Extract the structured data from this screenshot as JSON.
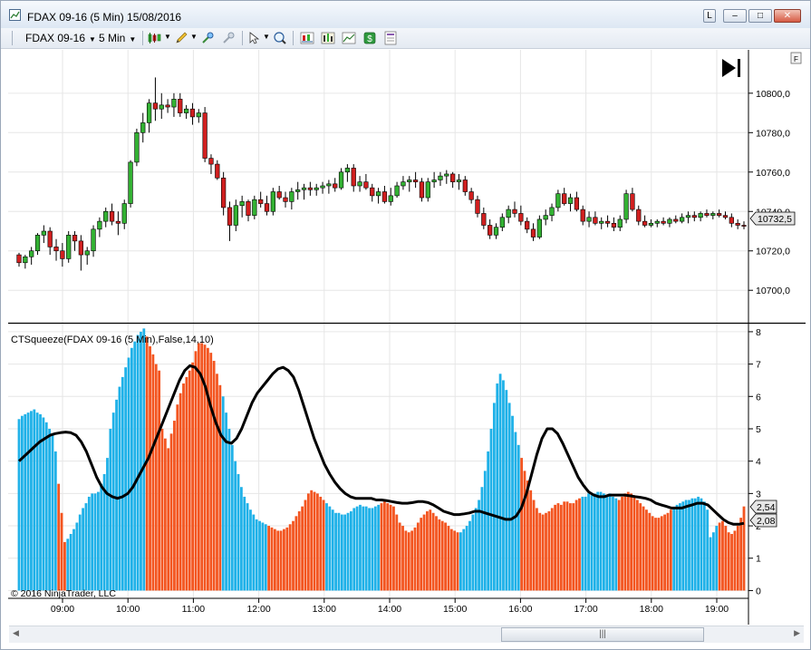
{
  "window": {
    "title": "FDAX 09-16 (5 Min)  15/08/2016",
    "buttons": {
      "link": "L",
      "minimize": "–",
      "maximize": "□",
      "close": "✕"
    }
  },
  "toolbar": {
    "instrument": "FDAX 09-16",
    "interval": "5 Min",
    "tools": [
      "chart-style-icon",
      "pencil-icon",
      "zoom-in-icon",
      "zoom-out-icon",
      "pointer-icon",
      "magnify-icon",
      "strategy-icon",
      "bars-icon",
      "line-chart-icon",
      "dollar-icon",
      "properties-icon"
    ]
  },
  "colors": {
    "up": "#33b233",
    "down": "#d11f1f",
    "cyan": "#1fb1e8",
    "orange": "#f35520",
    "line": "#000000",
    "grid": "#e6e6e6",
    "axis": "#000000"
  },
  "price_panel": {
    "f_button": "F",
    "last_price_label": "10732,5"
  },
  "indicator_panel": {
    "label": "CTSqueeze(FDAX 09-16 (5 Min),False,14,10)",
    "value_label_1": "2,54",
    "value_label_2": "2,08"
  },
  "copyright": "© 2016 NinjaTrader, LLC",
  "scrollbar": {
    "grip": "|||"
  },
  "chart_data": [
    {
      "type": "candlestick",
      "title": "FDAX 09-16 (5 Min)",
      "yticks": [
        "10700,0",
        "10720,0",
        "10740,0",
        "10760,0",
        "10780,0",
        "10800,0"
      ],
      "ytick_values": [
        10700,
        10720,
        10740,
        10760,
        10780,
        10800
      ],
      "ylim": [
        10684,
        10822
      ],
      "grid": true,
      "x_time_labels": [
        "09:00",
        "10:00",
        "11:00",
        "12:00",
        "13:00",
        "14:00",
        "15:00",
        "16:00",
        "17:00",
        "18:00",
        "19:00"
      ],
      "last_price": 10732.5,
      "ohlc": [
        [
          10718,
          10719,
          10712,
          10714
        ],
        [
          10714,
          10718,
          10711,
          10717
        ],
        [
          10717,
          10722,
          10713,
          10720
        ],
        [
          10720,
          10729,
          10718,
          10728
        ],
        [
          10728,
          10733,
          10724,
          10730
        ],
        [
          10730,
          10732,
          10718,
          10722
        ],
        [
          10722,
          10726,
          10715,
          10720
        ],
        [
          10720,
          10724,
          10712,
          10716
        ],
        [
          10716,
          10730,
          10714,
          10728
        ],
        [
          10728,
          10730,
          10720,
          10725
        ],
        [
          10725,
          10728,
          10710,
          10718
        ],
        [
          10718,
          10722,
          10713,
          10720
        ],
        [
          10720,
          10733,
          10717,
          10731
        ],
        [
          10731,
          10737,
          10727,
          10735
        ],
        [
          10735,
          10742,
          10732,
          10740
        ],
        [
          10740,
          10744,
          10733,
          10735
        ],
        [
          10735,
          10740,
          10728,
          10734
        ],
        [
          10734,
          10746,
          10731,
          10744
        ],
        [
          10744,
          10766,
          10742,
          10765
        ],
        [
          10765,
          10782,
          10763,
          10780
        ],
        [
          10780,
          10790,
          10775,
          10785
        ],
        [
          10785,
          10797,
          10780,
          10795
        ],
        [
          10795,
          10808,
          10786,
          10792
        ],
        [
          10792,
          10800,
          10787,
          10794
        ],
        [
          10794,
          10797,
          10790,
          10793
        ],
        [
          10793,
          10800,
          10788,
          10797
        ],
        [
          10797,
          10800,
          10788,
          10790
        ],
        [
          10790,
          10794,
          10787,
          10792
        ],
        [
          10792,
          10795,
          10784,
          10788
        ],
        [
          10788,
          10792,
          10785,
          10790
        ],
        [
          10790,
          10793,
          10765,
          10767
        ],
        [
          10767,
          10769,
          10759,
          10764
        ],
        [
          10764,
          10766,
          10756,
          10757
        ],
        [
          10757,
          10760,
          10738,
          10742
        ],
        [
          10742,
          10745,
          10725,
          10733
        ],
        [
          10733,
          10746,
          10730,
          10743
        ],
        [
          10743,
          10748,
          10737,
          10745
        ],
        [
          10745,
          10746,
          10735,
          10738
        ],
        [
          10738,
          10748,
          10736,
          10746
        ],
        [
          10746,
          10750,
          10742,
          10744
        ],
        [
          10744,
          10748,
          10738,
          10740
        ],
        [
          10740,
          10752,
          10738,
          10750
        ],
        [
          10750,
          10753,
          10746,
          10747
        ],
        [
          10747,
          10750,
          10742,
          10745
        ],
        [
          10745,
          10752,
          10741,
          10750
        ],
        [
          10750,
          10755,
          10746,
          10751
        ],
        [
          10751,
          10754,
          10746,
          10752
        ],
        [
          10752,
          10755,
          10748,
          10751
        ],
        [
          10751,
          10754,
          10748,
          10752
        ],
        [
          10752,
          10755,
          10749,
          10753
        ],
        [
          10753,
          10756,
          10749,
          10754
        ],
        [
          10754,
          10757,
          10750,
          10752
        ],
        [
          10752,
          10762,
          10751,
          10760
        ],
        [
          10760,
          10764,
          10755,
          10762
        ],
        [
          10762,
          10764,
          10750,
          10753
        ],
        [
          10753,
          10758,
          10750,
          10755
        ],
        [
          10755,
          10759,
          10751,
          10752
        ],
        [
          10752,
          10754,
          10745,
          10748
        ],
        [
          10748,
          10752,
          10744,
          10750
        ],
        [
          10750,
          10753,
          10744,
          10745
        ],
        [
          10745,
          10752,
          10743,
          10748
        ],
        [
          10748,
          10755,
          10747,
          10753
        ],
        [
          10753,
          10758,
          10751,
          10755
        ],
        [
          10755,
          10758,
          10750,
          10756
        ],
        [
          10756,
          10760,
          10752,
          10755
        ],
        [
          10755,
          10757,
          10745,
          10747
        ],
        [
          10747,
          10757,
          10745,
          10755
        ],
        [
          10755,
          10760,
          10752,
          10756
        ],
        [
          10756,
          10760,
          10753,
          10758
        ],
        [
          10758,
          10761,
          10754,
          10759
        ],
        [
          10759,
          10760,
          10752,
          10755
        ],
        [
          10755,
          10759,
          10751,
          10756
        ],
        [
          10756,
          10758,
          10748,
          10750
        ],
        [
          10750,
          10752,
          10744,
          10746
        ],
        [
          10746,
          10748,
          10737,
          10739
        ],
        [
          10739,
          10742,
          10731,
          10733
        ],
        [
          10733,
          10736,
          10726,
          10728
        ],
        [
          10728,
          10734,
          10726,
          10732
        ],
        [
          10732,
          10739,
          10730,
          10737
        ],
        [
          10737,
          10743,
          10734,
          10741
        ],
        [
          10741,
          10745,
          10737,
          10739
        ],
        [
          10739,
          10743,
          10733,
          10735
        ],
        [
          10735,
          10737,
          10729,
          10731
        ],
        [
          10731,
          10734,
          10725,
          10727
        ],
        [
          10727,
          10738,
          10726,
          10736
        ],
        [
          10736,
          10741,
          10733,
          10738
        ],
        [
          10738,
          10744,
          10735,
          10742
        ],
        [
          10742,
          10751,
          10740,
          10749
        ],
        [
          10749,
          10752,
          10743,
          10744
        ],
        [
          10744,
          10749,
          10740,
          10747
        ],
        [
          10747,
          10750,
          10740,
          10741
        ],
        [
          10741,
          10743,
          10733,
          10735
        ],
        [
          10735,
          10740,
          10732,
          10737
        ],
        [
          10737,
          10740,
          10733,
          10734
        ],
        [
          10734,
          10737,
          10731,
          10735
        ],
        [
          10735,
          10738,
          10732,
          10734
        ],
        [
          10734,
          10737,
          10730,
          10732
        ],
        [
          10732,
          10738,
          10730,
          10736
        ],
        [
          10736,
          10751,
          10734,
          10749
        ],
        [
          10749,
          10752,
          10740,
          10741
        ],
        [
          10741,
          10743,
          10733,
          10735
        ],
        [
          10735,
          10738,
          10732,
          10733
        ],
        [
          10733,
          10736,
          10732,
          10734
        ],
        [
          10734,
          10736,
          10732,
          10735
        ],
        [
          10735,
          10737,
          10733,
          10734
        ],
        [
          10734,
          10737,
          10732,
          10736
        ],
        [
          10736,
          10738,
          10734,
          10735
        ],
        [
          10735,
          10739,
          10734,
          10737
        ],
        [
          10737,
          10740,
          10734,
          10738
        ],
        [
          10738,
          10740,
          10735,
          10737
        ],
        [
          10737,
          10740,
          10735,
          10739
        ],
        [
          10739,
          10741,
          10737,
          10738
        ],
        [
          10738,
          10740,
          10736,
          10739
        ],
        [
          10739,
          10741,
          10737,
          10738
        ],
        [
          10738,
          10740,
          10736,
          10737
        ],
        [
          10737,
          10739,
          10732,
          10734
        ],
        [
          10734,
          10736,
          10731,
          10733
        ],
        [
          10733,
          10735,
          10731,
          10732.5
        ]
      ]
    },
    {
      "type": "bar",
      "title": "CTSqueeze(FDAX 09-16 (5 Min),False,14,10)",
      "yticks": [
        "0",
        "1",
        "2",
        "3",
        "4",
        "5",
        "6",
        "7",
        "8"
      ],
      "ylim": [
        -0.1,
        8.25
      ],
      "grid": true,
      "x_time_labels": [
        "09:00",
        "10:00",
        "11:00",
        "12:00",
        "13:00",
        "14:00",
        "15:00",
        "16:00",
        "17:00",
        "18:00",
        "19:00"
      ],
      "series": [
        {
          "name": "",
          "color": "cyan",
          "segments": [
            [
              0,
              12
            ],
            [
              16,
              41
            ],
            [
              67,
              81
            ],
            [
              101,
              118
            ],
            [
              145,
              164
            ],
            [
              185,
              196
            ],
            [
              215,
              229
            ],
            [
              245,
              254
            ],
            [
              263,
              281
            ]
          ]
        },
        {
          "name": "",
          "color": "orange",
          "segments": [
            [
              13,
              15
            ],
            [
              42,
              66
            ],
            [
              82,
              100
            ],
            [
              119,
              144
            ],
            [
              165,
              184
            ],
            [
              197,
              214
            ],
            [
              230,
              244
            ],
            [
              255,
              262
            ],
            [
              282,
              286
            ]
          ]
        }
      ],
      "values": [
        5.3,
        5.4,
        5.45,
        5.5,
        5.55,
        5.6,
        5.5,
        5.45,
        5.35,
        5.2,
        5.0,
        4.8,
        4.3,
        3.3,
        2.4,
        1.5,
        1.6,
        1.75,
        1.9,
        2.1,
        2.35,
        2.55,
        2.7,
        2.9,
        3.0,
        3.0,
        3.05,
        3.3,
        3.6,
        4.1,
        5.0,
        5.5,
        5.9,
        6.3,
        6.6,
        6.9,
        7.2,
        7.5,
        7.7,
        7.9,
        8.0,
        8.1,
        7.85,
        7.55,
        7.3,
        7.0,
        6.8,
        5.0,
        4.7,
        4.4,
        4.85,
        5.25,
        5.75,
        6.1,
        6.4,
        6.6,
        6.8,
        7.05,
        7.4,
        7.65,
        7.65,
        7.6,
        7.5,
        7.35,
        7.1,
        6.7,
        6.35,
        6.0,
        5.5,
        5.0,
        4.5,
        4.0,
        3.6,
        3.2,
        2.9,
        2.7,
        2.5,
        2.35,
        2.2,
        2.15,
        2.1,
        2.05,
        2.0,
        1.95,
        1.9,
        1.85,
        1.85,
        1.9,
        1.95,
        2.05,
        2.15,
        2.3,
        2.45,
        2.6,
        2.8,
        3.0,
        3.1,
        3.05,
        3.0,
        2.9,
        2.8,
        2.7,
        2.6,
        2.5,
        2.4,
        2.4,
        2.35,
        2.35,
        2.4,
        2.45,
        2.55,
        2.6,
        2.65,
        2.6,
        2.6,
        2.55,
        2.55,
        2.6,
        2.65,
        2.7,
        2.75,
        2.7,
        2.65,
        2.6,
        2.35,
        2.1,
        2.0,
        1.85,
        1.8,
        1.85,
        1.95,
        2.1,
        2.25,
        2.35,
        2.45,
        2.5,
        2.4,
        2.3,
        2.2,
        2.15,
        2.1,
        2.0,
        1.9,
        1.85,
        1.8,
        1.8,
        1.9,
        2.0,
        2.15,
        2.35,
        2.55,
        2.8,
        3.2,
        3.7,
        4.3,
        5.0,
        5.8,
        6.4,
        6.7,
        6.5,
        6.2,
        5.8,
        5.4,
        4.9,
        4.5,
        4.1,
        3.7,
        3.4,
        3.1,
        2.8,
        2.55,
        2.4,
        2.35,
        2.4,
        2.45,
        2.55,
        2.65,
        2.7,
        2.65,
        2.75,
        2.75,
        2.7,
        2.7,
        2.8,
        2.85,
        2.9,
        2.9,
        3.0,
        2.95,
        3.0,
        3.05,
        3.05,
        3.0,
        2.95,
        3.0,
        2.9,
        2.85,
        2.8,
        2.9,
        3.0,
        3.05,
        3.0,
        2.9,
        2.8,
        2.7,
        2.6,
        2.5,
        2.4,
        2.3,
        2.25,
        2.25,
        2.3,
        2.35,
        2.4,
        2.5,
        2.55,
        2.65,
        2.7,
        2.75,
        2.8,
        2.8,
        2.85,
        2.85,
        2.9,
        2.85,
        2.75,
        2.5,
        1.65,
        1.8,
        2.0,
        2.1,
        2.15,
        2.0,
        1.8,
        1.75,
        1.85,
        2.0,
        2.25,
        2.6
      ],
      "line_values": [
        4.0,
        4.15,
        4.3,
        4.45,
        4.6,
        4.7,
        4.8,
        4.85,
        4.88,
        4.9,
        4.88,
        4.8,
        4.6,
        4.3,
        3.9,
        3.5,
        3.2,
        3.0,
        2.9,
        2.85,
        2.9,
        3.0,
        3.2,
        3.5,
        3.8,
        4.1,
        4.5,
        4.9,
        5.3,
        5.7,
        6.1,
        6.5,
        6.8,
        6.95,
        6.9,
        6.7,
        6.3,
        5.7,
        5.2,
        4.8,
        4.6,
        4.55,
        4.7,
        5.0,
        5.4,
        5.8,
        6.1,
        6.3,
        6.5,
        6.7,
        6.85,
        6.9,
        6.8,
        6.6,
        6.2,
        5.7,
        5.2,
        4.7,
        4.3,
        3.9,
        3.6,
        3.35,
        3.15,
        3.0,
        2.9,
        2.85,
        2.85,
        2.85,
        2.85,
        2.8,
        2.8,
        2.78,
        2.75,
        2.72,
        2.7,
        2.7,
        2.72,
        2.75,
        2.75,
        2.72,
        2.65,
        2.55,
        2.45,
        2.4,
        2.35,
        2.35,
        2.37,
        2.4,
        2.45,
        2.45,
        2.4,
        2.35,
        2.3,
        2.25,
        2.2,
        2.2,
        2.3,
        2.55,
        3.0,
        3.6,
        4.2,
        4.7,
        5.0,
        5.0,
        4.85,
        4.55,
        4.2,
        3.85,
        3.5,
        3.25,
        3.05,
        2.95,
        2.9,
        2.9,
        2.95,
        2.95,
        2.95,
        2.95,
        2.93,
        2.9,
        2.88,
        2.85,
        2.8,
        2.7,
        2.65,
        2.6,
        2.55,
        2.55,
        2.55,
        2.6,
        2.65,
        2.7,
        2.7,
        2.65,
        2.5,
        2.35,
        2.2,
        2.1,
        2.05,
        2.05,
        2.08
      ]
    }
  ]
}
